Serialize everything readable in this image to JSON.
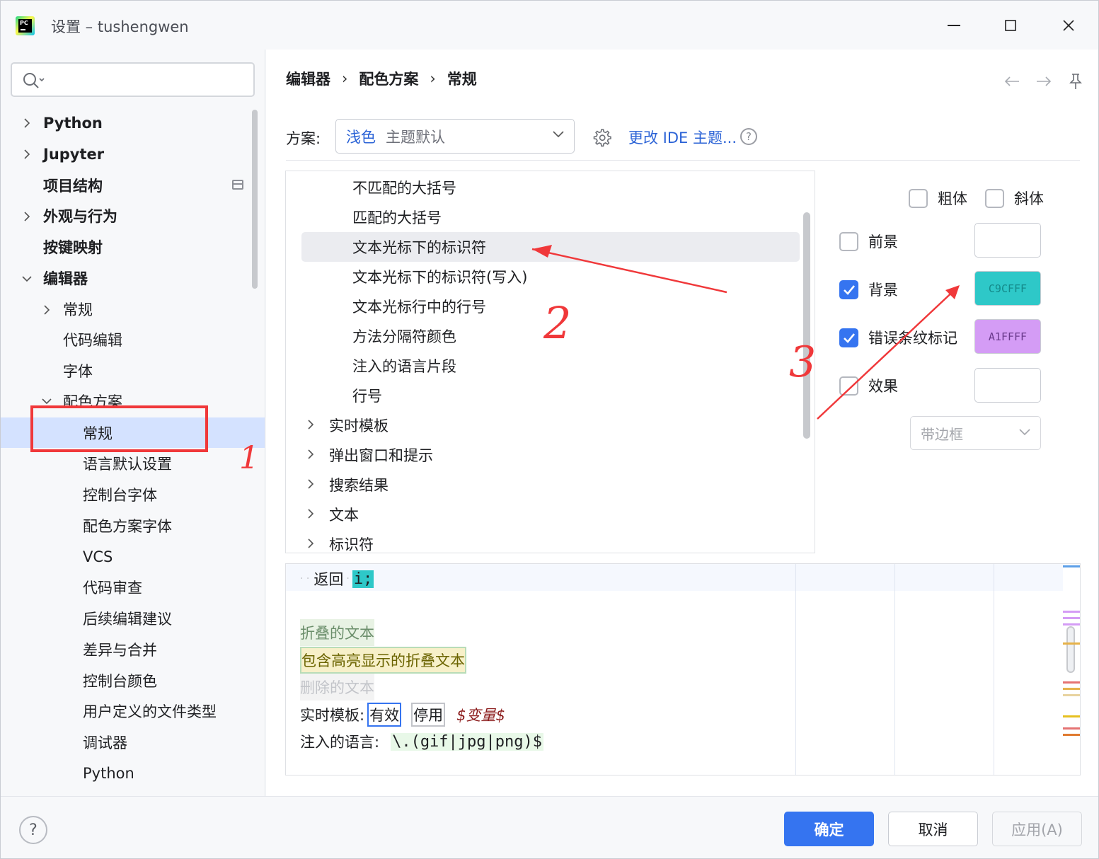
{
  "window": {
    "title": "设置 – tushengwen",
    "app_icon_text": "PC"
  },
  "sidebar": {
    "items": [
      {
        "label": "Python"
      },
      {
        "label": "Jupyter"
      },
      {
        "label": "项目结构"
      },
      {
        "label": "外观与行为"
      },
      {
        "label": "按键映射"
      },
      {
        "label": "编辑器"
      },
      {
        "label": "常规"
      },
      {
        "label": "代码编辑"
      },
      {
        "label": "字体"
      },
      {
        "label": "配色方案"
      },
      {
        "label": "常规"
      },
      {
        "label": "语言默认设置"
      },
      {
        "label": "控制台字体"
      },
      {
        "label": "配色方案字体"
      },
      {
        "label": "VCS"
      },
      {
        "label": "代码审查"
      },
      {
        "label": "后续编辑建议"
      },
      {
        "label": "差异与合并"
      },
      {
        "label": "控制台颜色"
      },
      {
        "label": "用户定义的文件类型"
      },
      {
        "label": "调试器"
      },
      {
        "label": "Python"
      }
    ]
  },
  "breadcrumb": [
    "编辑器",
    "配色方案",
    "常规"
  ],
  "scheme": {
    "label": "方案:",
    "value": "浅色",
    "hint": "主题默认",
    "ide_link": "更改 IDE 主题...",
    "help": "?"
  },
  "attributes_list": [
    {
      "label": "不匹配的大括号"
    },
    {
      "label": "匹配的大括号"
    },
    {
      "label": "文本光标下的标识符"
    },
    {
      "label": "文本光标下的标识符(写入)"
    },
    {
      "label": "文本光标行中的行号"
    },
    {
      "label": "方法分隔符颜色"
    },
    {
      "label": "注入的语言片段"
    },
    {
      "label": "行号"
    },
    {
      "label": "实时模板"
    },
    {
      "label": "弹出窗口和提示"
    },
    {
      "label": "搜索结果"
    },
    {
      "label": "文本"
    },
    {
      "label": "标识符"
    }
  ],
  "options": {
    "bold": {
      "label": "粗体",
      "checked": false
    },
    "italic": {
      "label": "斜体",
      "checked": false
    },
    "foreground": {
      "label": "前景",
      "checked": false,
      "color": ""
    },
    "background": {
      "label": "背景",
      "checked": true,
      "color": "C9CFFF",
      "swatch": "#2ec8c8"
    },
    "error_stripe": {
      "label": "错误条纹标记",
      "checked": true,
      "color": "A1FFFF",
      "swatch": "#d49cf5"
    },
    "effects": {
      "label": "效果",
      "checked": false,
      "color": "",
      "type": "带边框"
    }
  },
  "preview": {
    "line1_keyword": "返回",
    "line1_ident": "i;",
    "folded": "折叠的文本",
    "folded_highlight": "包含高亮显示的折叠文本",
    "deleted": "删除的文本",
    "live_template_label": "实时模板:",
    "live_active": "有效",
    "live_inactive": "停用",
    "live_var": "$变量$",
    "injected_label": "注入的语言:",
    "injected_code": "\\.(gif|jpg|png)$"
  },
  "footer": {
    "help": "?",
    "ok": "确定",
    "cancel": "取消",
    "apply": "应用(A)"
  },
  "annotations": {
    "mark1": "1",
    "mark2": "2",
    "mark3": "3"
  },
  "colors": {
    "accent": "#3574f0",
    "selection": "#d4e2ff",
    "annotation_red": "#f0383a"
  }
}
